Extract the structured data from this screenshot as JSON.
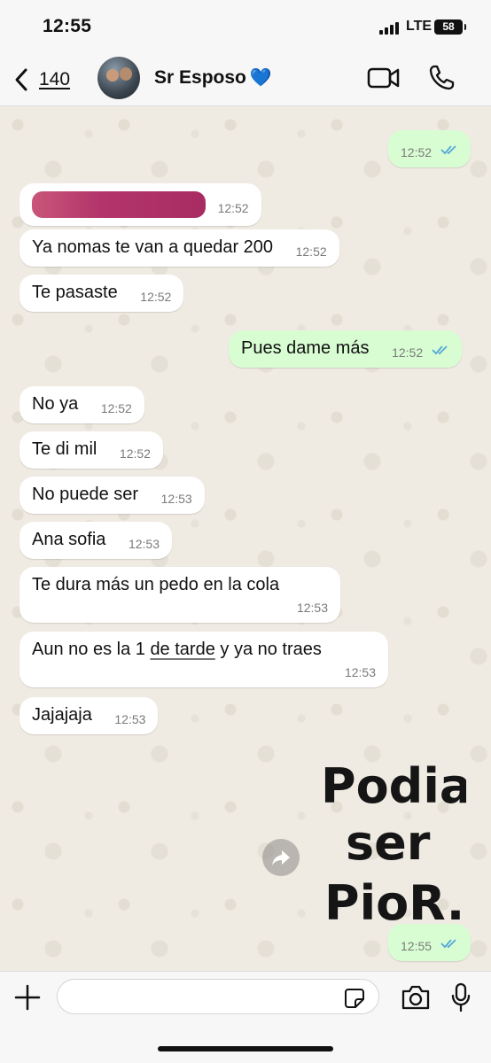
{
  "status_bar": {
    "time": "12:55",
    "network": "LTE",
    "battery": "58"
  },
  "header": {
    "back_count": "140",
    "contact_name": "Sr Esposo",
    "contact_emoji": "💙"
  },
  "messages": [
    {
      "text": "",
      "time": "12:52"
    },
    {
      "text": "12:52"
    },
    {
      "text": "Ya nomas te van a quedar 200",
      "time": "12:52"
    },
    {
      "text": "Te pasaste",
      "time": "12:52"
    },
    {
      "text": "Pues dame más",
      "time": "12:52"
    },
    {
      "text": "No ya",
      "time": "12:52"
    },
    {
      "text": "Te di mil",
      "time": "12:52"
    },
    {
      "text": "No puede ser",
      "time": "12:53"
    },
    {
      "text": "Ana sofia",
      "time": "12:53"
    },
    {
      "text": "Te dura más un pedo en la cola",
      "time": "12:53"
    },
    {
      "text_before": "Aun no es la 1 ",
      "text_link": "de tarde",
      "text_after": " y ya no traes",
      "time": "12:53"
    },
    {
      "text": "Jajajaja",
      "time": "12:53"
    },
    {
      "time": "12:55"
    }
  ],
  "sticker_text": "Podia ser PioR.",
  "colors": {
    "outgoing": "#d9fdd3",
    "incoming": "#ffffff",
    "read_ticks": "#53a8d8",
    "background": "#efeae2"
  }
}
